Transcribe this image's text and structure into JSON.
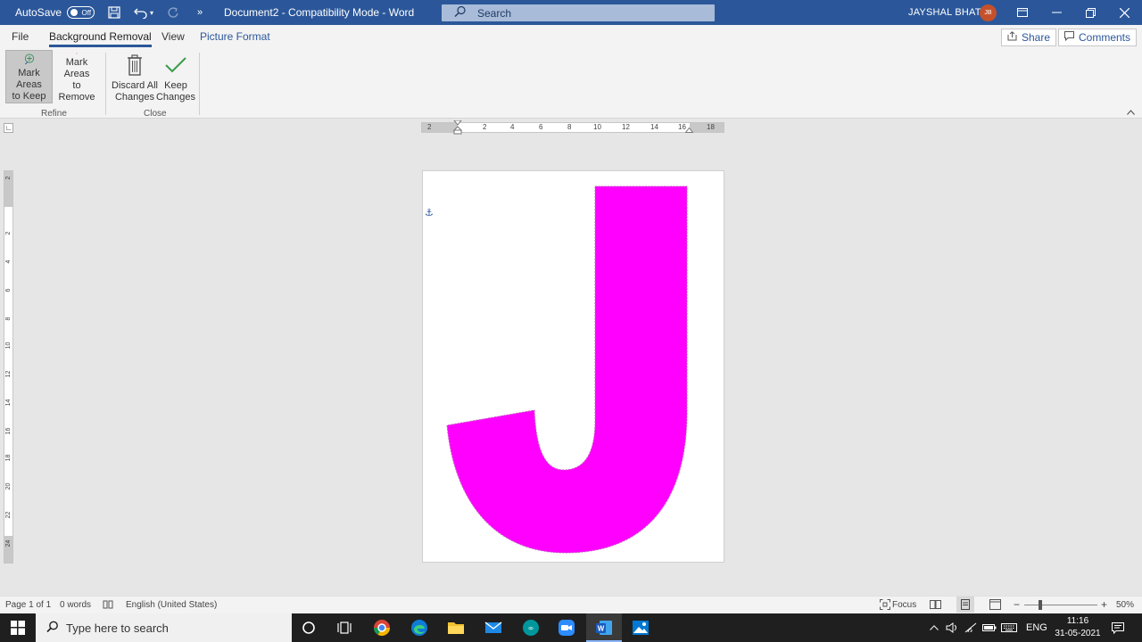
{
  "titlebar": {
    "autosave_label": "AutoSave",
    "autosave_state": "Off",
    "more": "»",
    "doc_title": "Document2  -  Compatibility Mode  -  Word",
    "search_placeholder": "Search",
    "username": "JAYSHAL BHATT",
    "avatar_initials": "JB"
  },
  "tabs": {
    "file": "File",
    "background_removal": "Background Removal",
    "view": "View",
    "picture_format": "Picture Format",
    "share": "Share",
    "comments": "Comments"
  },
  "ribbon": {
    "mark_keep_1": "Mark Areas",
    "mark_keep_2": "to Keep",
    "mark_remove_1": "Mark Areas",
    "mark_remove_2": "to Remove",
    "discard_1": "Discard All",
    "discard_2": "Changes",
    "keep_1": "Keep",
    "keep_2": "Changes",
    "group_refine": "Refine",
    "group_close": "Close"
  },
  "ruler": {
    "h_ticks": [
      "2",
      "2",
      "4",
      "6",
      "8",
      "10",
      "12",
      "14",
      "16",
      "18"
    ],
    "v_ticks": [
      "2",
      "2",
      "4",
      "6",
      "8",
      "10",
      "12",
      "14",
      "16",
      "18",
      "20",
      "22",
      "24"
    ]
  },
  "statusbar": {
    "page": "Page 1 of 1",
    "words": "0 words",
    "language": "English (United States)",
    "focus": "Focus",
    "zoom_minus": "−",
    "zoom_plus": "+",
    "zoom": "50%"
  },
  "taskbar": {
    "search_placeholder": "Type here to search",
    "language": "ENG",
    "time": "11:16",
    "date": "31-05-2021"
  },
  "colors": {
    "word_blue": "#2b579a",
    "keep_region": "#ff00ff"
  }
}
